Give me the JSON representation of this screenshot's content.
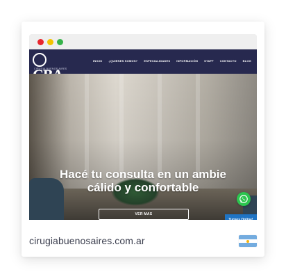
{
  "site": {
    "logo_text": "CBA",
    "logo_subtitle": "CIRUGIA BUENOS AIRES",
    "nav": [
      "INICIO",
      "¿QUIENES SOMOS?",
      "ESPECIALIDADES",
      "INFORMACIÓN",
      "STAFF",
      "CONTACTO",
      "BLOG"
    ],
    "hero_title_line1": "Hacé tu consulta en un ambie",
    "hero_title_line2": "cálido y confortable",
    "cta_label": "VER MAS",
    "turnos_label": "Turnos Online!"
  },
  "card": {
    "domain": "cirugiabuenosaires.com.ar"
  },
  "icons": {
    "whatsapp": "whatsapp-icon",
    "flag": "argentina-flag-icon"
  },
  "colors": {
    "navbar": "#27294f",
    "whatsapp": "#2cc54f",
    "turnos": "#1f74c4"
  }
}
